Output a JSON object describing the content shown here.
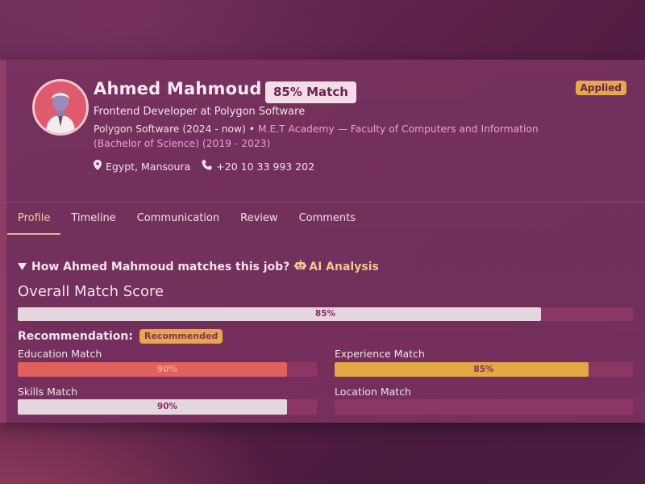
{
  "candidate": {
    "name": "Ahmed Mahmoud",
    "match_badge": "85% Match",
    "status": "Applied",
    "title": "Frontend Developer at Polygon Software",
    "experience_summary": "Polygon Software (2024 - now) • ",
    "education_summary": "M.E.T Academy — Faculty of Computers and Information (Bachelor of Science) (2019 - 2023)",
    "location": "Egypt, Mansoura",
    "phone": "+20 10 33 993 202"
  },
  "tabs": [
    {
      "label": "Profile",
      "active": true
    },
    {
      "label": "Timeline",
      "active": false
    },
    {
      "label": "Communication",
      "active": false
    },
    {
      "label": "Review",
      "active": false
    },
    {
      "label": "Comments",
      "active": false
    }
  ],
  "analysis": {
    "heading": "How Ahmed Mahmoud matches this job?",
    "ai_label": "AI Analysis",
    "overall_title": "Overall Match Score",
    "overall_score": {
      "value": 85,
      "text": "85%"
    },
    "recommendation_label": "Recommendation:",
    "recommendation_value": "Recommended",
    "metrics": {
      "education": {
        "label": "Education Match",
        "value": 90,
        "text": "90%",
        "color": "#e0605e"
      },
      "experience": {
        "label": "Experience Match",
        "value": 85,
        "text": "85%",
        "color": "#e2a844"
      },
      "skills": {
        "label": "Skills Match",
        "value": 90,
        "text": "90%",
        "color": "#e3d6dc"
      },
      "location": {
        "label": "Location Match",
        "value": 0,
        "text": "",
        "color": "#e3d6dc"
      }
    }
  },
  "colors": {
    "accent_gold": "#e6a84a",
    "bar_track": "#a03c6e",
    "overall_fill": "#e3d6dc"
  }
}
